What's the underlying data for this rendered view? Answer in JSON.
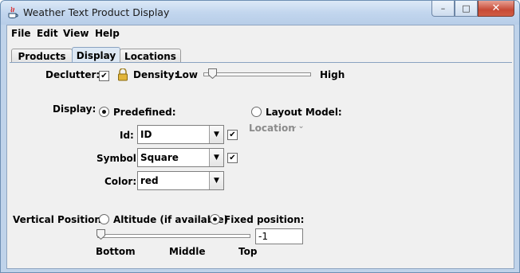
{
  "window": {
    "title": "Weather Text Product Display",
    "minimize": "–",
    "maximize": "□",
    "close": "✕"
  },
  "menu": {
    "file": "File",
    "edit": "Edit",
    "view": "View",
    "help": "Help"
  },
  "tabs": [
    {
      "label": "Products"
    },
    {
      "label": "Display",
      "selected": true
    },
    {
      "label": "Locations"
    }
  ],
  "declutter": {
    "label": "Declutter:",
    "checked": true,
    "density_label": "Density:",
    "low": "Low",
    "high": "High",
    "density_value": 0.05
  },
  "display": {
    "label": "Display:",
    "predefined_label": "Predefined:",
    "predefined_selected": true,
    "layout_label": "Layout Model:",
    "layout_selected": false,
    "location_label": "Location",
    "id_label": "Id:",
    "id_value": "ID",
    "id_checked": true,
    "symbol_label": "Symbol:",
    "symbol_value": "Square",
    "symbol_checked": true,
    "color_label": "Color:",
    "color_value": "red"
  },
  "vertical": {
    "label": "Vertical Position:",
    "altitude_label": "Altitude (if available)",
    "altitude_selected": false,
    "fixed_label": "Fixed position:",
    "fixed_selected": true,
    "value": "-1",
    "bottom": "Bottom",
    "middle": "Middle",
    "top": "Top",
    "slider_value": 0.0
  },
  "colors": {
    "accent": "#8aa3c1",
    "title_bg": "#c2d6ee"
  }
}
